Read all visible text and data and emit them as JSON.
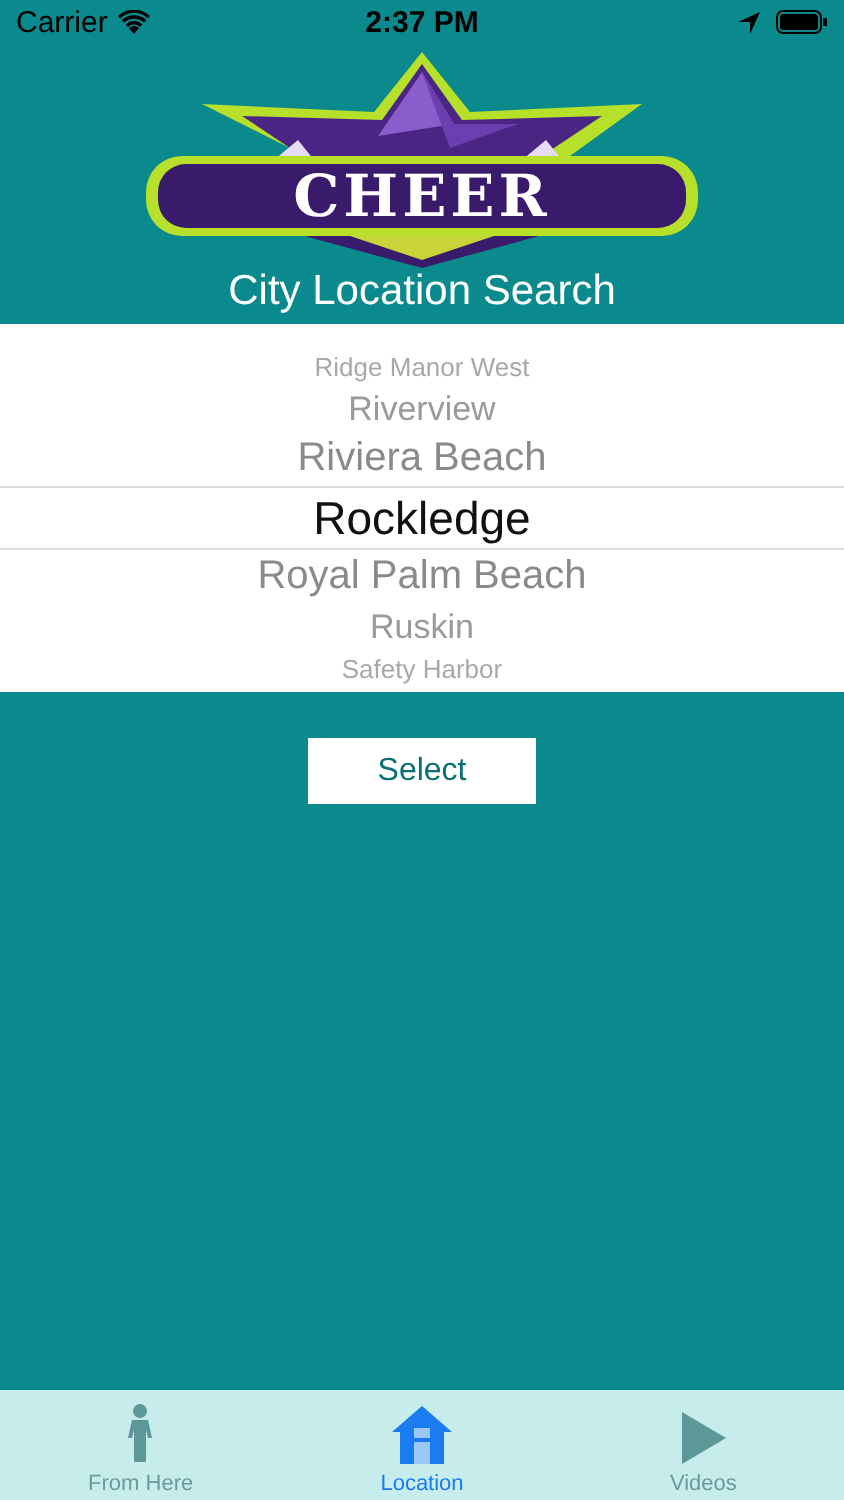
{
  "status_bar": {
    "carrier": "Carrier",
    "time": "2:37 PM"
  },
  "logo": {
    "text": "CHEER"
  },
  "title": "City Location Search",
  "picker": {
    "items": [
      {
        "label": "Ridge Manor West",
        "selected": false
      },
      {
        "label": "Riverview",
        "selected": false
      },
      {
        "label": "Riviera Beach",
        "selected": false
      },
      {
        "label": "Rockledge",
        "selected": true
      },
      {
        "label": "Royal Palm Beach",
        "selected": false
      },
      {
        "label": "Ruskin",
        "selected": false
      },
      {
        "label": "Safety Harbor",
        "selected": false
      }
    ]
  },
  "select_button": "Select",
  "tab_bar": [
    {
      "label": "From Here",
      "kind": "person",
      "selected": false
    },
    {
      "label": "Location",
      "kind": "house",
      "selected": true
    },
    {
      "label": "Videos",
      "kind": "play",
      "selected": false
    }
  ]
}
